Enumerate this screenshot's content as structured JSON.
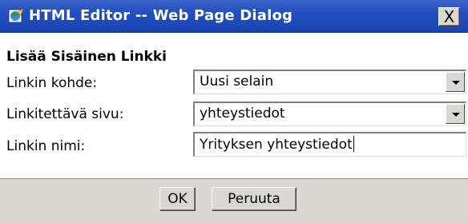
{
  "window": {
    "title": "HTML Editor -- Web Page Dialog",
    "close_label": "X",
    "icon": "html-editor-icon"
  },
  "form": {
    "heading": "Lisää Sisäinen Linkki",
    "fields": [
      {
        "label": "Linkin kohde:",
        "value": "Uusi selain",
        "type": "select"
      },
      {
        "label": "Linkitettävä sivu:",
        "value": "yhteystiedot",
        "type": "select"
      },
      {
        "label": "Linkin nimi:",
        "value": "Yrityksen yhteystiedot",
        "type": "text"
      }
    ]
  },
  "buttons": {
    "ok": "OK",
    "cancel": "Peruuta"
  },
  "colors": {
    "titlebar": "#2150c2",
    "dialog_bg": "#dbd8d1",
    "content_bg": "#ffffff"
  }
}
